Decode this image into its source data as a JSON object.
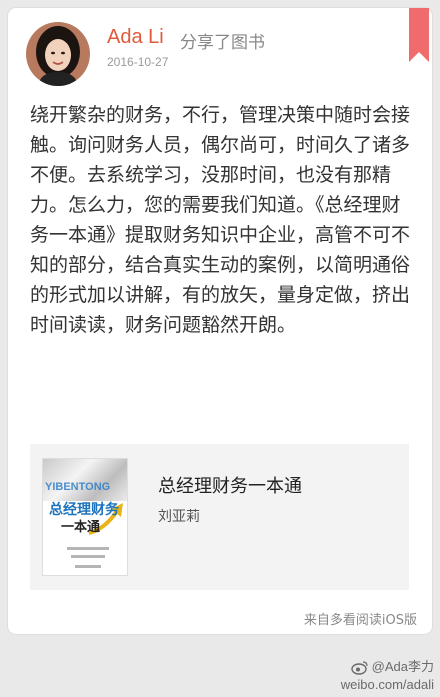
{
  "post": {
    "user_name": "Ada Li",
    "action_text": "分享了图书",
    "date": "2016-10-27",
    "body": "绕开繁杂的财务，不行，管理决策中随时会接触。询问财务人员，偶尔尚可，时间久了诸多不便。去系统学习，没那时间，也没有那精力。怎么力，您的需要我们知道。《总经理财务一本通》提取财务知识中企业，高管不可不知的部分，结合真实生动的案例，以简明通俗的形式加以讲解，有的放矢，量身定做，挤出时间读读，财务问题豁然开朗。",
    "source_text": "来自多看阅读iOS版"
  },
  "book": {
    "title": "总经理财务一本通",
    "author": "刘亚莉",
    "cover": {
      "latin_text": "YIBENTONG",
      "title_line1": "总经理财务",
      "title_line2": "一本通"
    }
  },
  "watermark": {
    "handle": "@Ada李力",
    "url": "weibo.com/adali"
  },
  "colors": {
    "username": "#e05a3a",
    "bookmark": "#f06b6b",
    "card_background": "#ffffff",
    "page_background": "#e9e9e9",
    "book_card_background": "#f3f3f3"
  },
  "icons": {
    "bookmark": "bookmark-ribbon-icon",
    "avatar": "user-avatar",
    "weibo": "weibo-icon"
  }
}
